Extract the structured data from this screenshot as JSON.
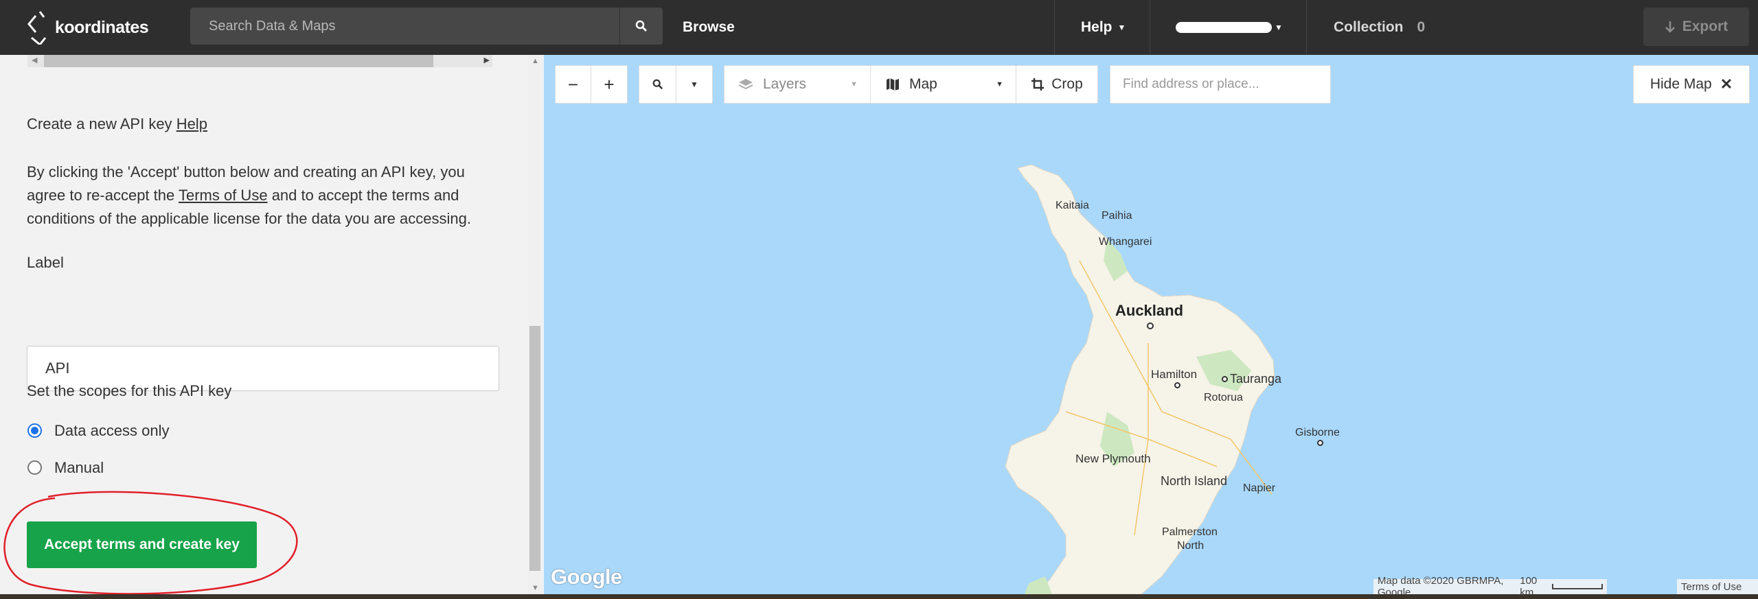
{
  "header": {
    "logo_text": "koordinates",
    "search_placeholder": "Search Data & Maps",
    "browse_label": "Browse",
    "help_label": "Help",
    "collection_label": "Collection",
    "collection_count": "0",
    "export_label": "Export"
  },
  "sidebar": {
    "create_key_title": "Create a new API key",
    "help_link": "Help",
    "terms_line1": "By clicking the 'Accept' button below and creating an API key, you",
    "terms_line2_a": "agree to re-accept the",
    "terms_link": "Terms of Use",
    "terms_line2_b": "and to accept the terms and",
    "terms_line3": "conditions of the applicable license for the data you are accessing.",
    "label_heading": "Label",
    "label_value": "API",
    "scopes_heading": "Set the scopes for this API key",
    "scope_options": [
      {
        "label": "Data access only",
        "checked": true
      },
      {
        "label": "Manual",
        "checked": false
      }
    ],
    "accept_button": "Accept terms and create key"
  },
  "map": {
    "layers_label": "Layers",
    "map_label": "Map",
    "crop_label": "Crop",
    "find_placeholder": "Find address or place...",
    "hide_map_label": "Hide Map",
    "google_logo": "Google",
    "attribution": "Map data ©2020 GBRMPA, Google",
    "scale_label": "100 km",
    "terms_label": "Terms of Use",
    "places": {
      "kaitaia": "Kaitaia",
      "paihia": "Paihia",
      "whangarei": "Whangarei",
      "auckland": "Auckland",
      "hamilton": "Hamilton",
      "tauranga": "Tauranga",
      "rotorua": "Rotorua",
      "gisborne": "Gisborne",
      "new_plymouth": "New Plymouth",
      "north_island": "North Island",
      "napier": "Napier",
      "palmerston": "Palmerston",
      "north": "North"
    }
  },
  "colors": {
    "topbar": "#2e2e2e",
    "accept_green": "#17a34a",
    "water": "#a9d8fb",
    "land": "#f6f3e8",
    "annotation_red": "#e0202a"
  }
}
